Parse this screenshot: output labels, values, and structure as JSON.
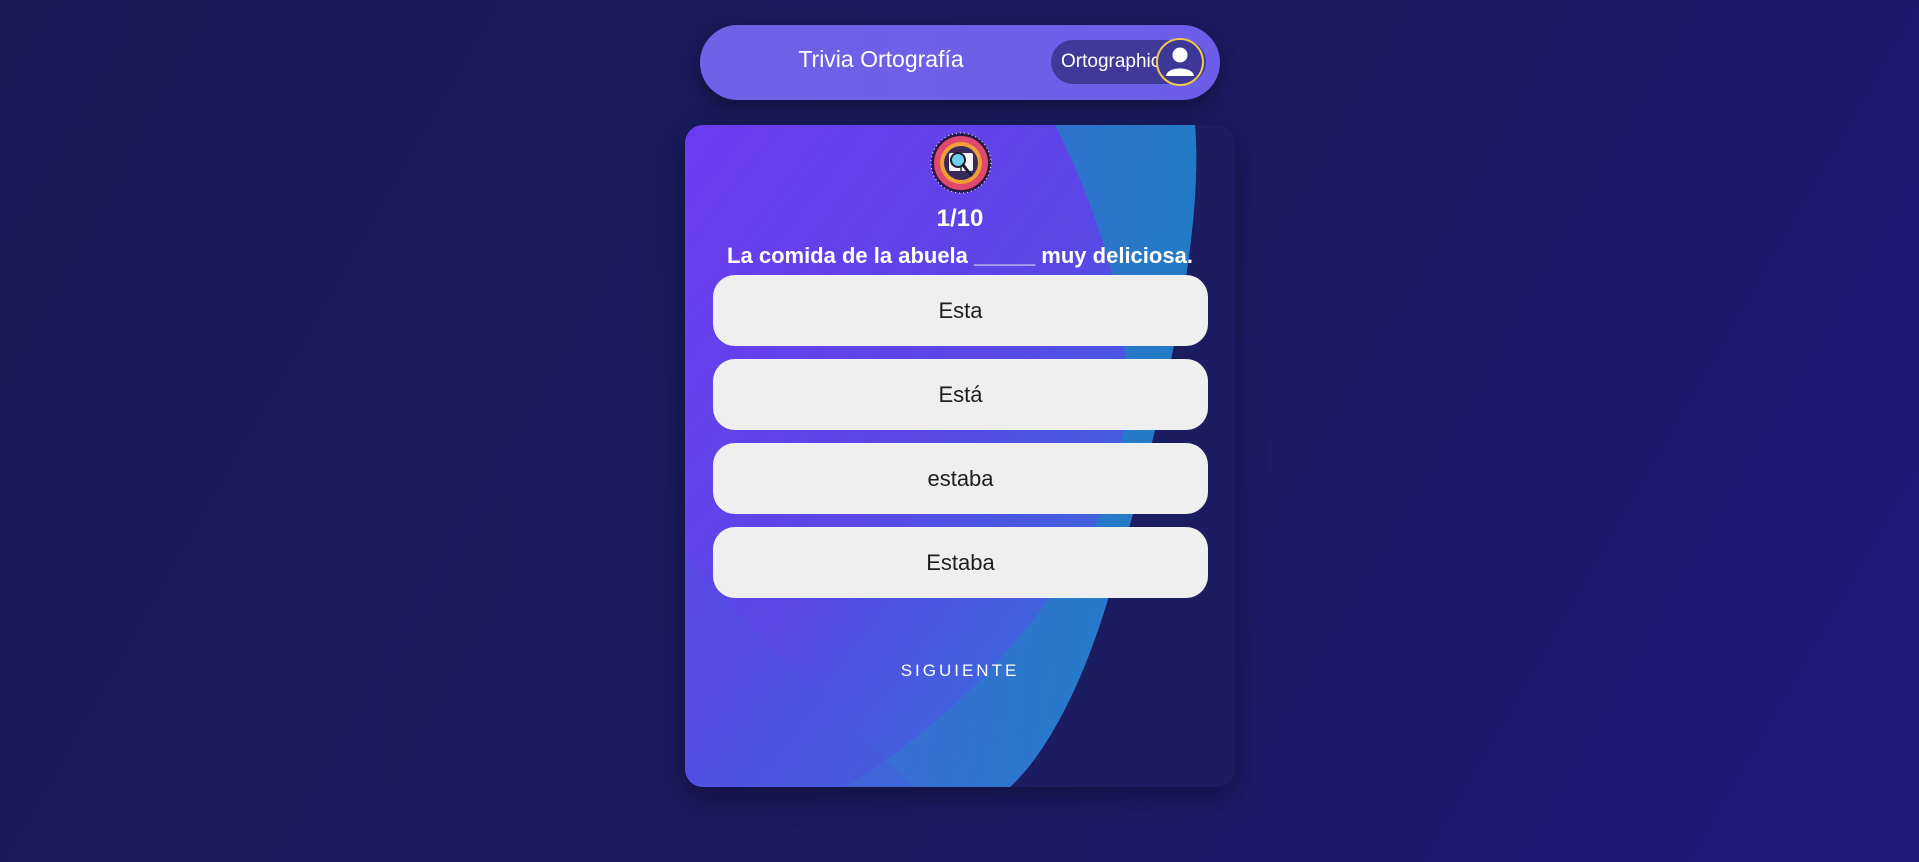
{
  "header": {
    "title": "Trivia Ortografía",
    "username": "Ortographic"
  },
  "quiz": {
    "progress": "1/10",
    "question": "La comida de la abuela _____ muy deliciosa.",
    "options": [
      "Esta",
      "Está",
      "estaba",
      "Estaba"
    ],
    "next_label": "SIGUIENTE"
  },
  "colors": {
    "background": "#1a1b5e",
    "header_bg": "#6c5ee8",
    "card_purple": "#6a3cf0",
    "card_blue": "#1d7fbf",
    "option_bg": "#efefef",
    "avatar_ring": "#f1c94d"
  },
  "icons": {
    "avatar": "user-avatar-icon",
    "logo": "magnifier-book-badge-icon"
  }
}
